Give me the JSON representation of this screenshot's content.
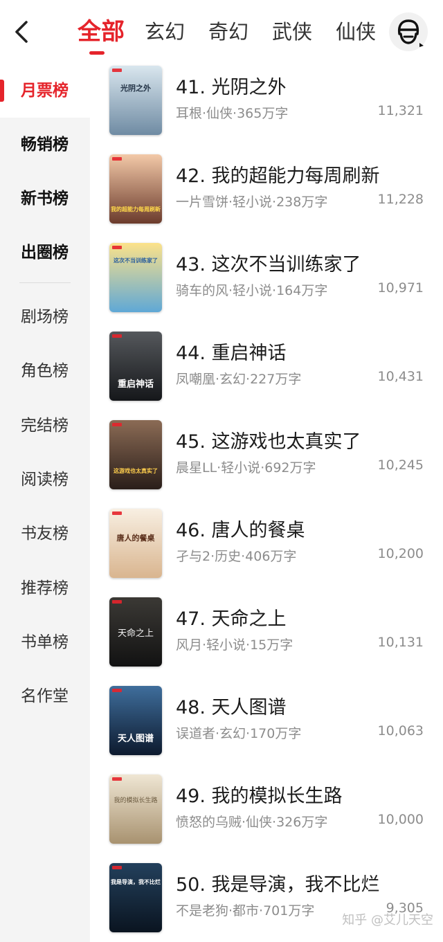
{
  "header": {
    "back_icon": "chevron-left-icon",
    "tabs": [
      {
        "label": "全部",
        "active": true
      },
      {
        "label": "玄幻",
        "active": false
      },
      {
        "label": "奇幻",
        "active": false
      },
      {
        "label": "武侠",
        "active": false
      },
      {
        "label": "仙侠",
        "active": false
      }
    ],
    "avatar_icon": "user-avatar-icon"
  },
  "sidebar": {
    "items": [
      {
        "label": "月票榜",
        "active": true,
        "bold": true
      },
      {
        "label": "畅销榜",
        "active": false,
        "bold": true
      },
      {
        "label": "新书榜",
        "active": false,
        "bold": true
      },
      {
        "label": "出圈榜",
        "active": false,
        "bold": true
      },
      {
        "label": "剧场榜",
        "active": false,
        "bold": false
      },
      {
        "label": "角色榜",
        "active": false,
        "bold": false
      },
      {
        "label": "完结榜",
        "active": false,
        "bold": false
      },
      {
        "label": "阅读榜",
        "active": false,
        "bold": false
      },
      {
        "label": "书友榜",
        "active": false,
        "bold": false
      },
      {
        "label": "推荐榜",
        "active": false,
        "bold": false
      },
      {
        "label": "书单榜",
        "active": false,
        "bold": false
      },
      {
        "label": "名作堂",
        "active": false,
        "bold": false
      }
    ]
  },
  "books": [
    {
      "title": "41. 光阴之外",
      "meta": "耳根·仙侠·365万字",
      "votes": "11,321",
      "cover_text": "光阴之外",
      "cover_colors": [
        "#d9e6ee",
        "#6f8ba3"
      ]
    },
    {
      "title": "42. 我的超能力每周刷新",
      "meta": "一片雪饼·轻小说·238万字",
      "votes": "11,228",
      "cover_text": "我的超能力每周刷新",
      "cover_colors": [
        "#f3c9a8",
        "#6b3b2c"
      ]
    },
    {
      "title": "43. 这次不当训练家了",
      "meta": "骑车的风·轻小说·164万字",
      "votes": "10,971",
      "cover_text": "这次不当训练家了",
      "cover_colors": [
        "#fce28a",
        "#5fa8d6"
      ]
    },
    {
      "title": "44. 重启神话",
      "meta": "凤嘲凰·玄幻·227万字",
      "votes": "10,431",
      "cover_text": "重启神话",
      "cover_colors": [
        "#55585c",
        "#15171a"
      ]
    },
    {
      "title": "45. 这游戏也太真实了",
      "meta": "晨星LL·轻小说·692万字",
      "votes": "10,245",
      "cover_text": "这游戏也太真实了",
      "cover_colors": [
        "#8b6b55",
        "#2a1e19"
      ]
    },
    {
      "title": "46. 唐人的餐桌",
      "meta": "孑与2·历史·406万字",
      "votes": "10,200",
      "cover_text": "唐人的餐桌",
      "cover_colors": [
        "#f8efe2",
        "#d9b58f"
      ]
    },
    {
      "title": "47. 天命之上",
      "meta": "风月·轻小说·15万字",
      "votes": "10,131",
      "cover_text": "天命之上",
      "cover_colors": [
        "#3b3935",
        "#121212"
      ]
    },
    {
      "title": "48. 天人图谱",
      "meta": "误道者·玄幻·170万字",
      "votes": "10,063",
      "cover_text": "天人图谱",
      "cover_colors": [
        "#3f6e9c",
        "#0d1a2e"
      ]
    },
    {
      "title": "49. 我的模拟长生路",
      "meta": "愤怒的乌贼·仙侠·326万字",
      "votes": "10,000",
      "cover_text": "我的模拟长生路",
      "cover_colors": [
        "#efe6d4",
        "#a89270"
      ]
    },
    {
      "title": "50. 我是导演，我不比烂",
      "meta": "不是老狗·都市·701万字",
      "votes": "9,305",
      "cover_text": "我是导演，我不比烂",
      "cover_colors": [
        "#23405c",
        "#0a1420"
      ]
    }
  ],
  "watermark": "知乎 @艾儿天空",
  "colors": {
    "accent": "#e5242b",
    "muted_text": "#8c8c8c",
    "sidebar_bg": "#f4f4f4"
  }
}
